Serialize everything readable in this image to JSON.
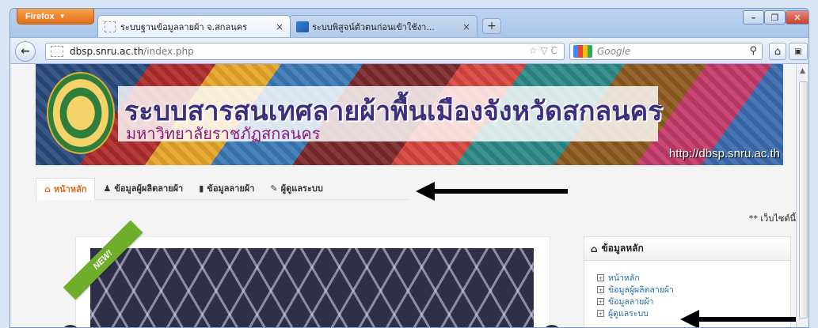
{
  "browser": {
    "menu_button": "Firefox",
    "tabs": [
      {
        "title": "ระบบฐานข้อมูลลายผ้า จ.สกลนคร",
        "close": "×"
      },
      {
        "title": "ระบบพิสูจน์ตัวตนก่อนเข้าใช้งา...",
        "close": "×"
      }
    ],
    "new_tab": "+",
    "window_controls": {
      "minimize": "–",
      "maximize": "❐",
      "close": "✕"
    },
    "back": "←",
    "url": {
      "host": "dbsp.snru.ac.th",
      "path": "/index.php",
      "icons": "☆ ▽ C"
    },
    "search_placeholder": "Google",
    "search_icon": "⚲",
    "home_icon": "⌂",
    "bookmarks_icon": "▣"
  },
  "site": {
    "title": "ระบบสารสนเทศลายผ้าพื้นเมืองจังหวัดสกลนคร",
    "subtitle": "มหาวิทยาลัยราชภัฏสกลนคร",
    "banner_url": "http://dbsp.snru.ac.th",
    "menu": [
      {
        "icon": "⌂",
        "label": "หน้าหลัก"
      },
      {
        "icon": "♟",
        "label": "ข้อมูลผู้ผลิตลายผ้า"
      },
      {
        "icon": "▮",
        "label": "ข้อมูลลายผ้า"
      },
      {
        "icon": "✎",
        "label": "ผู้ดูแลระบบ"
      }
    ],
    "marquee": "** เว็บไซต์นี้",
    "ribbon": "NEW!",
    "sidebar": {
      "heading": "ข้อมูลหลัก",
      "items": [
        "หน้าหลัก",
        "ข้อมูลผู้ผลิตลายผ้า",
        "ข้อมูลลายผ้า",
        "ผู้ดูแลระบบ"
      ]
    }
  },
  "scrollbar": {
    "up": "▲"
  }
}
